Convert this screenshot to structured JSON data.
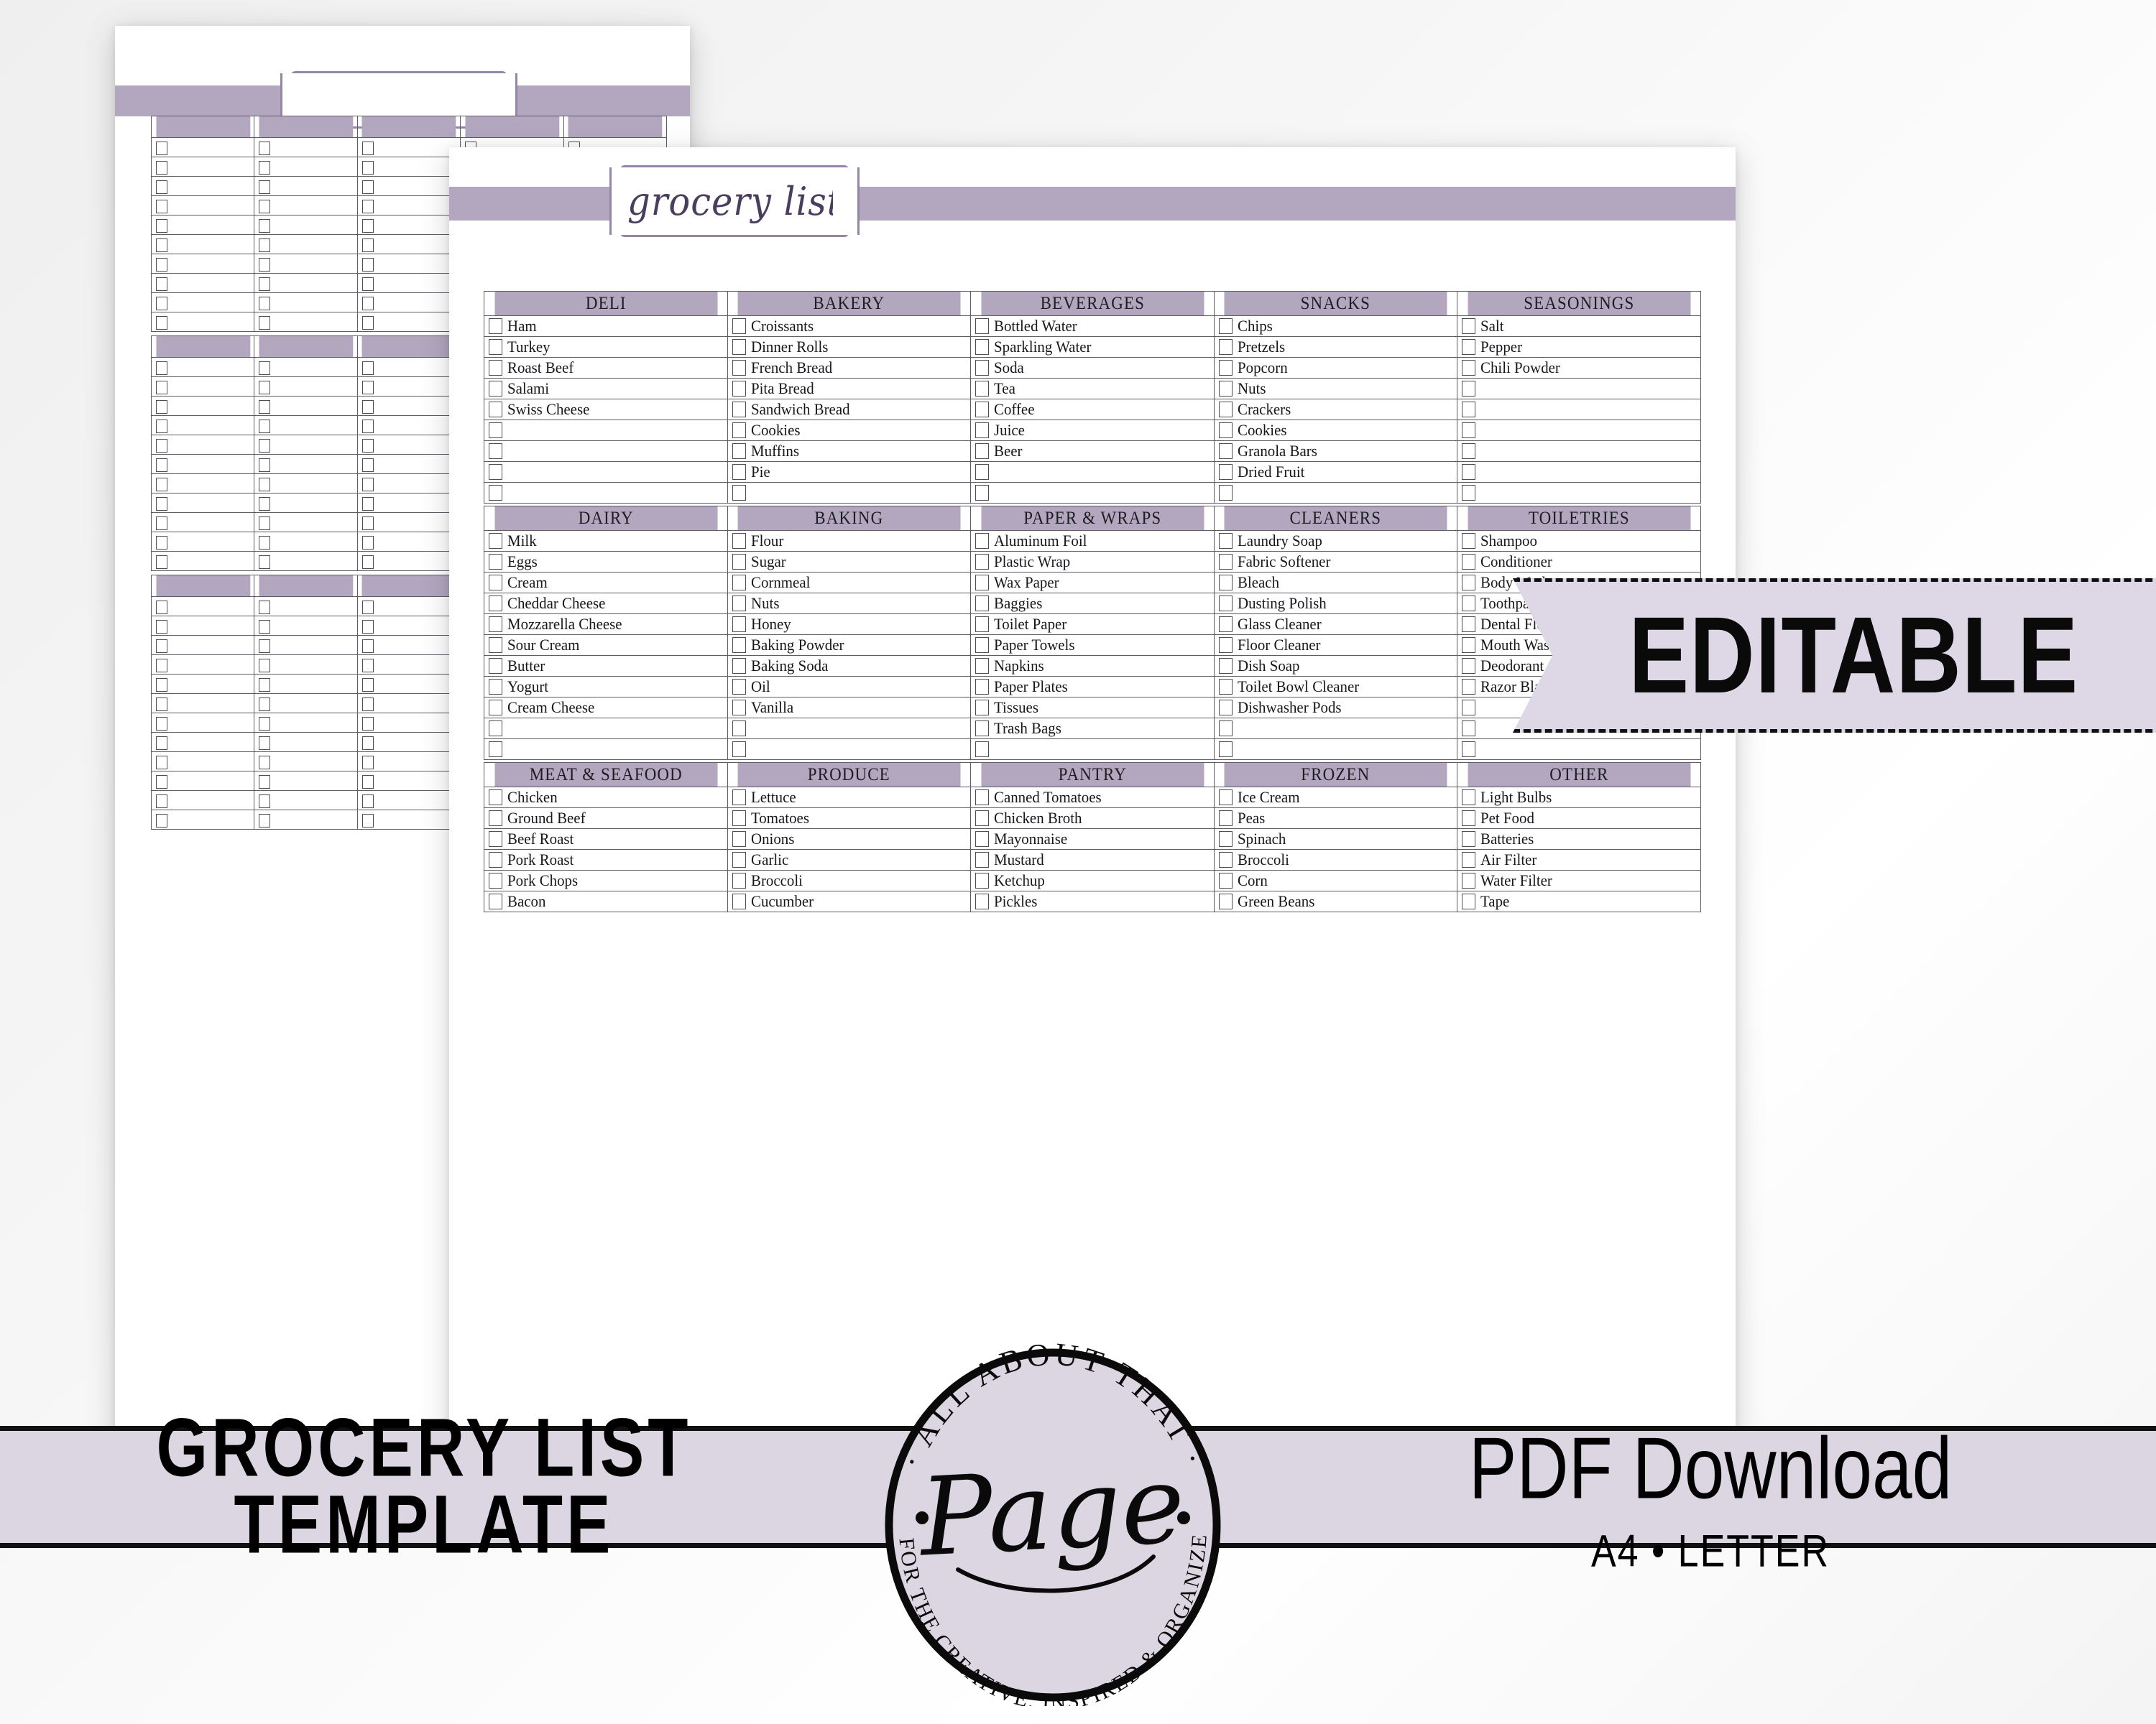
{
  "product": {
    "banner_title_line1": "GROCERY LIST",
    "banner_title_line2": "TEMPLATE",
    "format_line1": "PDF Download",
    "format_line2": "A4 • LETTER",
    "editable_badge": "EDITABLE"
  },
  "brand": {
    "top_arc": "· ALL ABOUT THAT ·",
    "wordmark": "Page",
    "bottom_arc": "PAGES FOR THE CREATIVE, INSPIRED & ORGANIZED LIFE"
  },
  "colors": {
    "lavender_header": "#b3a7c0",
    "lavender_banner": "#dcd6e3",
    "plaque_border": "#9586a8",
    "script_ink": "#4a3d5e",
    "rule": "#5d5d66",
    "ink": "#17171b"
  },
  "front_page": {
    "title": "grocery list",
    "sections": [
      {
        "columns": [
          {
            "header": "DELI",
            "items": [
              "Ham",
              "Turkey",
              "Roast Beef",
              "Salami",
              "Swiss Cheese",
              "",
              "",
              "",
              ""
            ]
          },
          {
            "header": "BAKERY",
            "items": [
              "Croissants",
              "Dinner Rolls",
              "French Bread",
              "Pita Bread",
              "Sandwich Bread",
              "Cookies",
              "Muffins",
              "Pie",
              ""
            ]
          },
          {
            "header": "BEVERAGES",
            "items": [
              "Bottled Water",
              "Sparkling Water",
              "Soda",
              "Tea",
              "Coffee",
              "Juice",
              "Beer",
              "",
              ""
            ]
          },
          {
            "header": "SNACKS",
            "items": [
              "Chips",
              "Pretzels",
              "Popcorn",
              "Nuts",
              "Crackers",
              "Cookies",
              "Granola Bars",
              "Dried Fruit",
              ""
            ]
          },
          {
            "header": "SEASONINGS",
            "items": [
              "Salt",
              "Pepper",
              "Chili Powder",
              "",
              "",
              "",
              "",
              "",
              ""
            ]
          }
        ]
      },
      {
        "columns": [
          {
            "header": "DAIRY",
            "items": [
              "Milk",
              "Eggs",
              "Cream",
              "Cheddar Cheese",
              "Mozzarella Cheese",
              "Sour Cream",
              "Butter",
              "Yogurt",
              "Cream Cheese",
              "",
              ""
            ]
          },
          {
            "header": "BAKING",
            "items": [
              "Flour",
              "Sugar",
              "Cornmeal",
              "Nuts",
              "Honey",
              "Baking Powder",
              "Baking Soda",
              "Oil",
              "Vanilla",
              "",
              ""
            ]
          },
          {
            "header": "PAPER & WRAPS",
            "items": [
              "Aluminum Foil",
              "Plastic Wrap",
              "Wax Paper",
              "Baggies",
              "Toilet Paper",
              "Paper Towels",
              "Napkins",
              "Paper Plates",
              "Tissues",
              "Trash Bags",
              ""
            ]
          },
          {
            "header": "CLEANERS",
            "items": [
              "Laundry Soap",
              "Fabric Softener",
              "Bleach",
              "Dusting Polish",
              "Glass Cleaner",
              "Floor Cleaner",
              "Dish Soap",
              "Toilet Bowl Cleaner",
              "Dishwasher Pods",
              "",
              ""
            ]
          },
          {
            "header": "TOILETRIES",
            "items": [
              "Shampoo",
              "Conditioner",
              "Body Wash",
              "Toothpaste",
              "Dental Floss",
              "Mouth Wash",
              "Deodorant",
              "Razor Blades",
              "",
              "",
              ""
            ]
          }
        ]
      },
      {
        "columns": [
          {
            "header": "MEAT & SEAFOOD",
            "items": [
              "Chicken",
              "Ground Beef",
              "Beef Roast",
              "Pork Roast",
              "Pork Chops",
              "Bacon"
            ]
          },
          {
            "header": "PRODUCE",
            "items": [
              "Lettuce",
              "Tomatoes",
              "Onions",
              "Garlic",
              "Broccoli",
              "Cucumber"
            ]
          },
          {
            "header": "PANTRY",
            "items": [
              "Canned Tomatoes",
              "Chicken Broth",
              "Mayonnaise",
              "Mustard",
              "Ketchup",
              "Pickles"
            ]
          },
          {
            "header": "FROZEN",
            "items": [
              "Ice Cream",
              "Peas",
              "Spinach",
              "Broccoli",
              "Corn",
              "Green Beans"
            ]
          },
          {
            "header": "OTHER",
            "items": [
              "Light Bulbs",
              "Pet Food",
              "Batteries",
              "Air Filter",
              "Water Filter",
              "Tape"
            ]
          }
        ]
      }
    ]
  },
  "back_page": {
    "title": "",
    "sections": [
      {
        "columns": [
          {
            "header": "",
            "rows": 10
          },
          {
            "header": "",
            "rows": 10
          },
          {
            "header": "",
            "rows": 10
          },
          {
            "header": "",
            "rows": 10
          },
          {
            "header": "",
            "rows": 10
          }
        ]
      },
      {
        "columns": [
          {
            "header": "",
            "rows": 11
          },
          {
            "header": "",
            "rows": 11
          },
          {
            "header": "",
            "rows": 11
          },
          {
            "header": "",
            "rows": 11
          },
          {
            "header": "",
            "rows": 11
          }
        ]
      },
      {
        "columns": [
          {
            "header": "",
            "rows": 12
          },
          {
            "header": "",
            "rows": 12
          },
          {
            "header": "",
            "rows": 12
          },
          {
            "header": "",
            "rows": 12
          },
          {
            "header": "",
            "rows": 12
          }
        ]
      }
    ]
  }
}
